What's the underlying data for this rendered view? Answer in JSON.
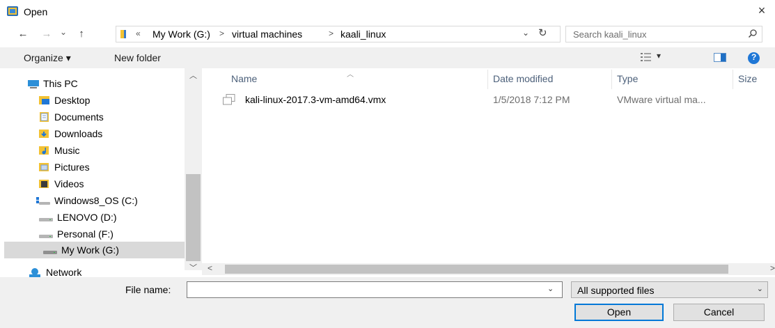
{
  "window": {
    "title": "Open",
    "close_glyph": "×"
  },
  "nav": {
    "back_glyph": "←",
    "forward_glyph": "→",
    "recent_glyph": "⌄",
    "up_glyph": "↑"
  },
  "address": {
    "overflow_glyph": "«",
    "separator_glyph": ">",
    "crumbs": [
      "My Work (G:)",
      "virtual machines",
      "kaali_linux"
    ],
    "dropdown_glyph": "⌄",
    "refresh_glyph": "↻"
  },
  "search": {
    "placeholder": "Search kaali_linux"
  },
  "toolbar": {
    "organize_label": "Organize",
    "organize_caret": "▾",
    "new_folder_label": "New folder",
    "view_caret": "▾",
    "help_glyph": "?"
  },
  "sidebar": {
    "items": [
      {
        "label": "This PC",
        "icon": "computer-icon"
      },
      {
        "label": "Desktop",
        "icon": "desktop-folder-icon"
      },
      {
        "label": "Documents",
        "icon": "documents-folder-icon"
      },
      {
        "label": "Downloads",
        "icon": "downloads-folder-icon"
      },
      {
        "label": "Music",
        "icon": "music-folder-icon"
      },
      {
        "label": "Pictures",
        "icon": "pictures-folder-icon"
      },
      {
        "label": "Videos",
        "icon": "videos-folder-icon"
      },
      {
        "label": "Windows8_OS (C:)",
        "icon": "system-drive-icon"
      },
      {
        "label": "LENOVO (D:)",
        "icon": "drive-icon"
      },
      {
        "label": "Personal (F:)",
        "icon": "drive-icon"
      },
      {
        "label": "My Work (G:)",
        "icon": "drive-icon",
        "selected": true
      },
      {
        "label": "Network",
        "icon": "network-icon"
      }
    ],
    "scroll_up_glyph": "︿",
    "scroll_down_glyph": "﹀"
  },
  "files": {
    "columns": [
      "Name",
      "Date modified",
      "Type",
      "Size"
    ],
    "sort_glyph": "︿",
    "rows": [
      {
        "name": "kali-linux-2017.3-vm-amd64.vmx",
        "date": "1/5/2018 7:12 PM",
        "type": "VMware virtual ma..."
      }
    ],
    "hscroll_left_glyph": "<",
    "hscroll_right_glyph": ">"
  },
  "footer": {
    "filename_label": "File name:",
    "filename_value": "",
    "filename_dropdown_glyph": "⌄",
    "filter_value": "All supported files",
    "filter_dropdown_glyph": "⌄",
    "open_label": "Open",
    "cancel_label": "Cancel"
  },
  "colors": {
    "accent": "#0078d7",
    "folder": "#f3c233",
    "column_header": "#4c607a"
  }
}
